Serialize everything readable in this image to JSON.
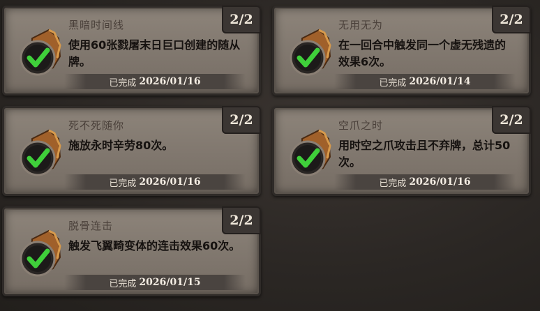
{
  "achievements": [
    {
      "title": "黑暗时间线",
      "desc": "使用60张戮屠末日巨口创建的随从牌。",
      "progress": "2/2",
      "done_label": "已完成",
      "date": "2026/01/16"
    },
    {
      "title": "无用无为",
      "desc": "在一回合中触发同一个虚无残遗的效果6次。",
      "progress": "2/2",
      "done_label": "已完成",
      "date": "2026/01/14"
    },
    {
      "title": "死不死随你",
      "desc": "施放永时辛劳80次。",
      "progress": "2/2",
      "done_label": "已完成",
      "date": "2026/01/16"
    },
    {
      "title": "空爪之时",
      "desc": "用时空之爪攻击且不弃牌，总计50次。",
      "progress": "2/2",
      "done_label": "已完成",
      "date": "2026/01/16"
    },
    {
      "title": "脱骨连击",
      "desc": "触发飞翼畸变体的连击效果60次。",
      "progress": "2/2",
      "done_label": "已完成",
      "date": "2026/01/15"
    }
  ],
  "colors": {
    "check": "#3fcf3a",
    "badge": "#2e2a28",
    "scroll": "#b06a2a"
  },
  "icon": "completed-check-icon"
}
